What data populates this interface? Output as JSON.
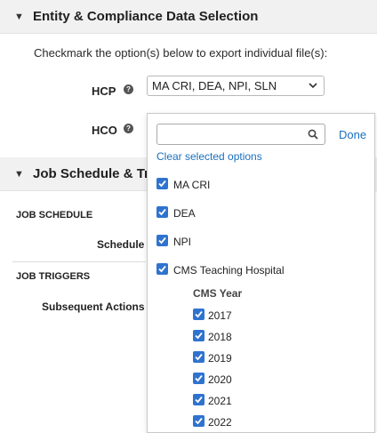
{
  "section1": {
    "title": "Entity & Compliance Data Selection",
    "caret": "▼"
  },
  "intro_text": "Checkmark the option(s) below to export individual file(s):",
  "fields": {
    "hcp": {
      "label": "HCP",
      "help": "?",
      "value": "MA CRI, DEA, NPI, SLN"
    },
    "hco": {
      "label": "HCO",
      "help": "?"
    }
  },
  "section2": {
    "title": "Job Schedule & Triggers",
    "caret": "▼"
  },
  "job_schedule": {
    "heading": "JOB SCHEDULE",
    "schedule_label": "Schedule"
  },
  "job_triggers": {
    "heading": "JOB TRIGGERS",
    "subsequent_label": "Subsequent Actions"
  },
  "dropdown": {
    "search_value": "",
    "done_label": "Done",
    "clear_label": "Clear selected options",
    "options": [
      {
        "label": "MA CRI",
        "checked": true
      },
      {
        "label": "DEA",
        "checked": true
      },
      {
        "label": "NPI",
        "checked": true
      },
      {
        "label": "CMS Teaching Hospital",
        "checked": true
      }
    ],
    "group": {
      "heading": "CMS Year",
      "options": [
        {
          "label": "2017",
          "checked": true
        },
        {
          "label": "2018",
          "checked": true
        },
        {
          "label": "2019",
          "checked": true
        },
        {
          "label": "2020",
          "checked": true
        },
        {
          "label": "2021",
          "checked": true
        },
        {
          "label": "2022",
          "checked": true
        }
      ]
    }
  },
  "colors": {
    "accent": "#2f73cf",
    "link": "#1a6fbe",
    "header_bg": "#f1f1f1"
  }
}
